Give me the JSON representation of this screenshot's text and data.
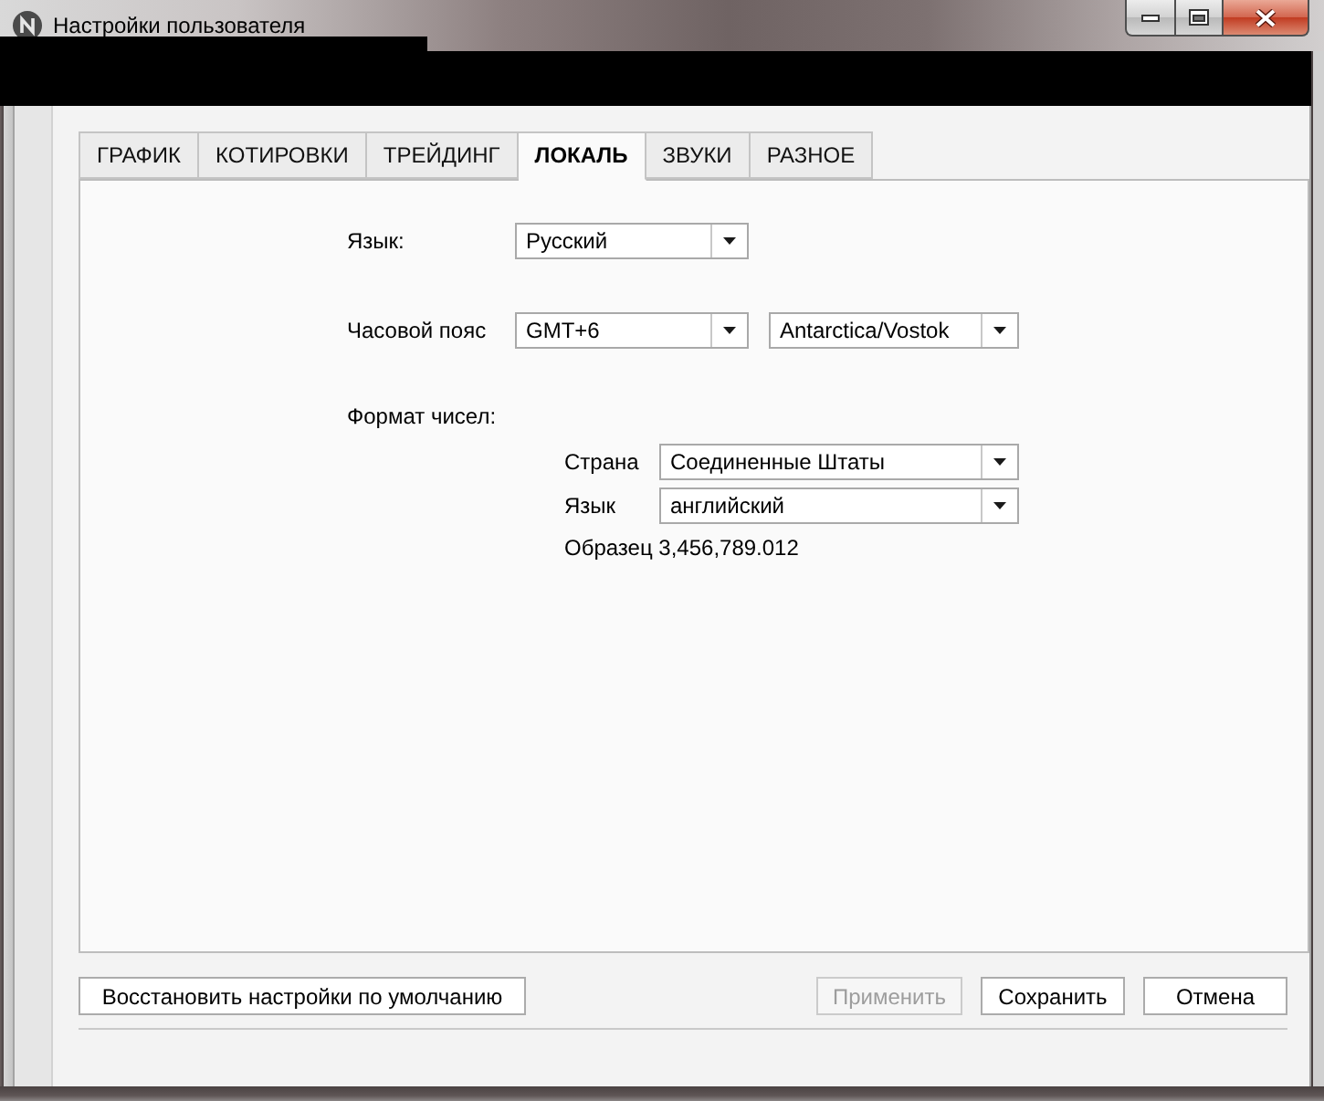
{
  "window": {
    "title": "Настройки пользователя"
  },
  "tabs": [
    {
      "label": "ГРАФИК",
      "selected": false
    },
    {
      "label": "КОТИРОВКИ",
      "selected": false
    },
    {
      "label": "ТРЕЙДИНГ",
      "selected": false
    },
    {
      "label": "ЛОКАЛЬ",
      "selected": true
    },
    {
      "label": "ЗВУКИ",
      "selected": false
    },
    {
      "label": "РАЗНОЕ",
      "selected": false
    }
  ],
  "locale": {
    "language": {
      "label": "Язык:",
      "value": "Русский"
    },
    "time_zone": {
      "label": "Часовой пояс",
      "offset": "GMT+6",
      "zone": "Antarctica/Vostok"
    },
    "number_format": {
      "label": "Формат чисел:",
      "country": {
        "label": "Страна",
        "value": "Соединенные Штаты"
      },
      "language": {
        "label": "Язык",
        "value": "английский"
      },
      "sample": "Образец 3,456,789.012"
    }
  },
  "footer": {
    "reset_button": "Восстановить настройки по умолчанию",
    "buttons": [
      {
        "label": "Применить",
        "disabled": true
      },
      {
        "label": "Сохранить",
        "disabled": false
      },
      {
        "label": "Отмена",
        "disabled": false
      }
    ]
  }
}
